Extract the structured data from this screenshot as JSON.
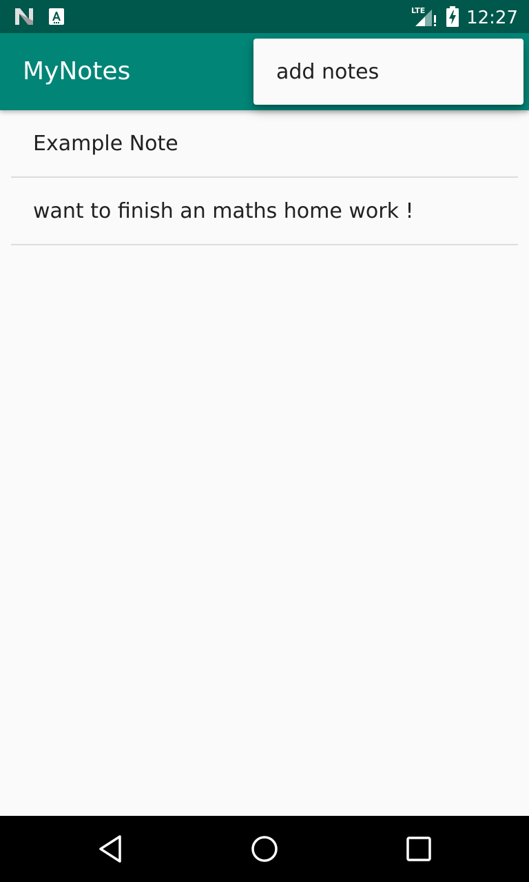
{
  "status_bar": {
    "time": "12:27",
    "network": "LTE",
    "icons": [
      "n-logo-icon",
      "keyboard-a-icon",
      "lte-signal-icon",
      "battery-charging-icon"
    ]
  },
  "app_bar": {
    "title": "MyNotes",
    "background_color": "#008577"
  },
  "overflow_menu": {
    "items": [
      {
        "label": "add notes"
      }
    ]
  },
  "notes": [
    {
      "text": "Example Note"
    },
    {
      "text": "want to finish an maths home work !"
    }
  ],
  "nav_bar": {
    "icons": [
      "back-icon",
      "home-icon",
      "recents-icon"
    ]
  }
}
